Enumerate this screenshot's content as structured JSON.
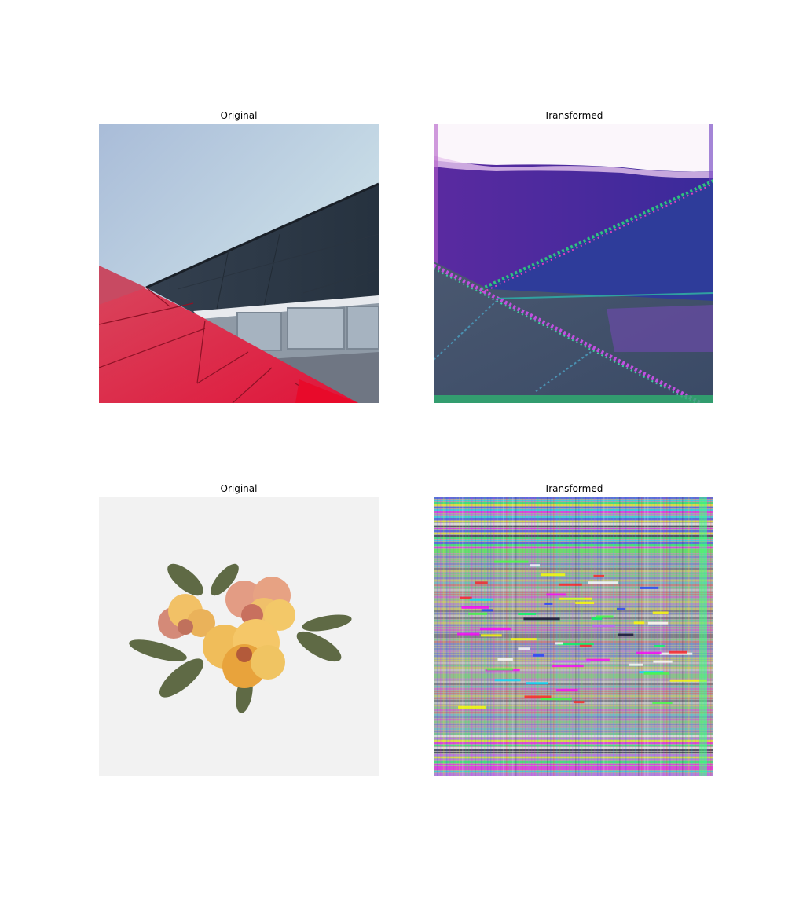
{
  "panels": [
    {
      "title": "Original",
      "image": "architecture-photo"
    },
    {
      "title": "Transformed",
      "image": "architecture-transformed"
    },
    {
      "title": "Original",
      "image": "flower-illustration"
    },
    {
      "title": "Transformed",
      "image": "flower-transformed"
    }
  ]
}
